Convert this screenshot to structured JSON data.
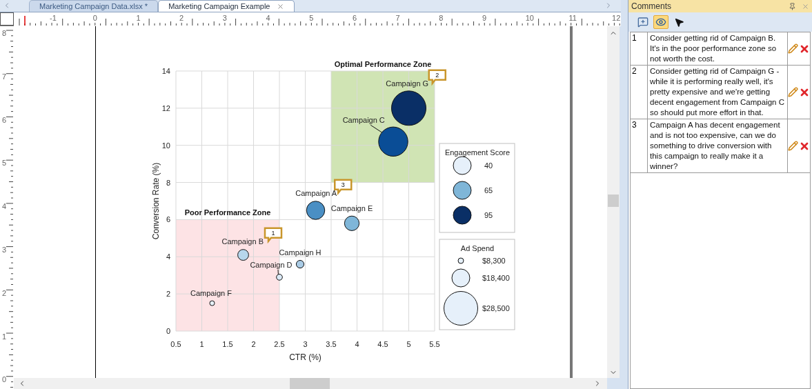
{
  "tabs": [
    {
      "label": "Marketing Campaign Data.xlsx *",
      "selected": false
    },
    {
      "label": "Marketing Campaign Example",
      "selected": true
    }
  ],
  "rulers": {
    "horizontal": [
      "-1",
      "0",
      "1",
      "2",
      "3",
      "4",
      "5",
      "6",
      "7",
      "8",
      "9",
      "10",
      "11",
      "12"
    ],
    "vertical": [
      "8",
      "7",
      "6",
      "5",
      "4",
      "3",
      "2",
      "1",
      "0"
    ]
  },
  "chart": {
    "chart_data": {
      "type": "scatter",
      "xlabel": "CTR (%)",
      "ylabel": "Conversion Rate (%)",
      "xlim": [
        0.5,
        5.5
      ],
      "ylim": [
        0,
        14
      ],
      "xticks": [
        0.5,
        1,
        1.5,
        2,
        2.5,
        3,
        3.5,
        4,
        4.5,
        5,
        5.5
      ],
      "yticks": [
        0,
        2,
        4,
        6,
        8,
        10,
        12,
        14
      ],
      "grid": true,
      "x": [
        5,
        4.7,
        3.2,
        3.9,
        1.8,
        2.9,
        2.5,
        1.2
      ],
      "series": [
        {
          "values": [
            12,
            10.2,
            6.5,
            5.8,
            4.1,
            3.6,
            2.9,
            1.5
          ],
          "sizes": [
            1,
            0.72,
            0.28,
            0.18,
            0.1,
            0.05,
            0.03,
            0.02
          ]
        }
      ]
    },
    "bubbles": [
      {
        "label": "Campaign G",
        "color": "#0a2f66",
        "kind": "plain"
      },
      {
        "label": "Campaign C",
        "color": "#0a4d96",
        "kind": "leader"
      },
      {
        "label": "Campaign A",
        "color": "#4a8fc4",
        "kind": "plain"
      },
      {
        "label": "Campaign E",
        "color": "#7fb6d8",
        "kind": "plain"
      },
      {
        "label": "Campaign B",
        "color": "#b7d6ec",
        "kind": "plain"
      },
      {
        "label": "Campaign H",
        "color": "#a9cbe5",
        "kind": "plain"
      },
      {
        "label": "Campaign D",
        "color": "#dbe9f6",
        "kind": "leader"
      },
      {
        "label": "Campaign F",
        "color": "#e6f0fa",
        "kind": "plain"
      }
    ],
    "zones": [
      {
        "kind": "optimal",
        "text": "Optimal Performance Zone",
        "color": "#d0e4b4"
      },
      {
        "kind": "poor",
        "text": "Poor Performance Zone",
        "color": "#fde3e5"
      }
    ],
    "comment_markers": [
      "1",
      "2",
      "3"
    ],
    "legends": [
      {
        "title": "Engagement Score",
        "kind": "color",
        "items": [
          {
            "label": "40",
            "color": "#e6f0fa"
          },
          {
            "label": "65",
            "color": "#7fb6d8"
          },
          {
            "label": "95",
            "color": "#0a2f66"
          }
        ]
      },
      {
        "title": "Ad Spend",
        "kind": "size",
        "items": [
          {
            "label": "$8,300"
          },
          {
            "label": "$18,400"
          },
          {
            "label": "$28,500"
          }
        ]
      }
    ]
  },
  "comments_panel": {
    "title": "Comments",
    "toolbar": [
      {
        "kind": "add-comment",
        "selected": false
      },
      {
        "kind": "show-comments",
        "selected": true
      },
      {
        "kind": "pointer",
        "selected": false
      }
    ],
    "comments": [
      {
        "number": "1",
        "text": "Consider getting rid of Campaign B. It's in the poor performance zone so not worth the cost."
      },
      {
        "number": "2",
        "text": "Consider getting rid of Campaign G - while it is performing really well, it's pretty expensive and we're getting decent engagement from Campaign C so should put more effort in that."
      },
      {
        "number": "3",
        "text": "Campaign A has decent engagement and is not too expensive, can we do something to drive conversion with this campaign to really make it a winner?"
      }
    ]
  }
}
